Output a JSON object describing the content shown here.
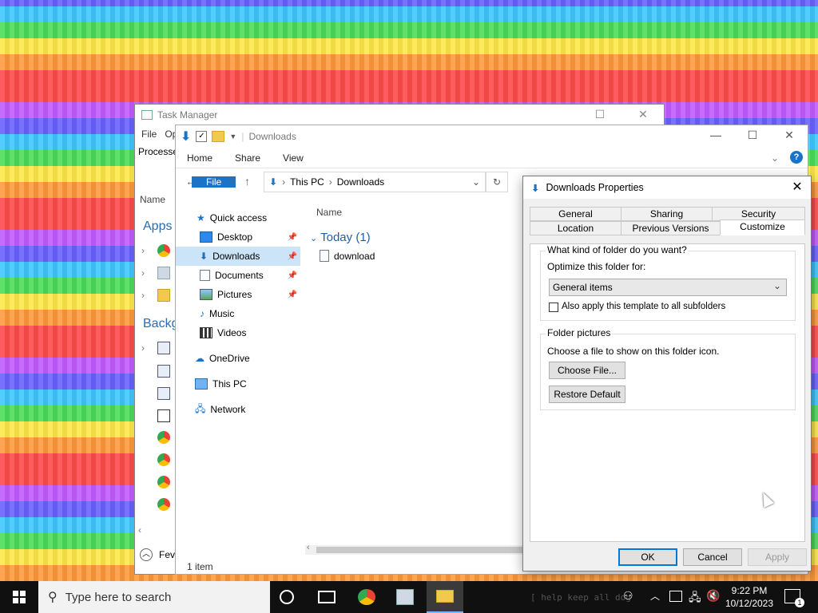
{
  "task_manager": {
    "title": "Task Manager",
    "menu": [
      "File",
      "Op"
    ],
    "tab_processes": "Processe",
    "col_name": "Name",
    "sec_apps": "Apps",
    "sec_background": "Backg",
    "fewer_details": "Fev"
  },
  "explorer": {
    "title": "Downloads",
    "ribbon_tabs": [
      "File",
      "Home",
      "Share",
      "View"
    ],
    "breadcrumb": [
      "This PC",
      "Downloads"
    ],
    "nav_items": [
      {
        "label": "Quick access"
      },
      {
        "label": "Desktop"
      },
      {
        "label": "Downloads"
      },
      {
        "label": "Documents"
      },
      {
        "label": "Pictures"
      },
      {
        "label": "Music"
      },
      {
        "label": "Videos"
      },
      {
        "label": "OneDrive"
      },
      {
        "label": "This PC"
      },
      {
        "label": "Network"
      }
    ],
    "column_name": "Name",
    "group": "Today (1)",
    "file": "download",
    "status": "1 item"
  },
  "dialog": {
    "title": "Downloads Properties",
    "tabs_row1": [
      "General",
      "Sharing",
      "Security"
    ],
    "tabs_row2": [
      "Location",
      "Previous Versions",
      "Customize"
    ],
    "q_kind": "What kind of folder do you want?",
    "optimize_label": "Optimize this folder for:",
    "optimize_value": "General items",
    "apply_subfolders": "Also apply this template to all subfolders",
    "folder_pictures": "Folder pictures",
    "choose_file_text": "Choose a file to show on this folder icon.",
    "choose_file_btn": "Choose File...",
    "restore_default_btn": "Restore Default",
    "ok": "OK",
    "cancel": "Cancel",
    "apply": "Apply"
  },
  "taskbar": {
    "search_placeholder": "Type here to search",
    "time": "9:22 PM",
    "date": "10/12/2023",
    "watermark": "[ help keep all  dog",
    "notification_count": "1"
  },
  "colors": {
    "accent": "#0078d7",
    "ribbon_file": "#1a73c7",
    "nav_selected": "#cce4f7",
    "group_text": "#1f5fa8"
  }
}
